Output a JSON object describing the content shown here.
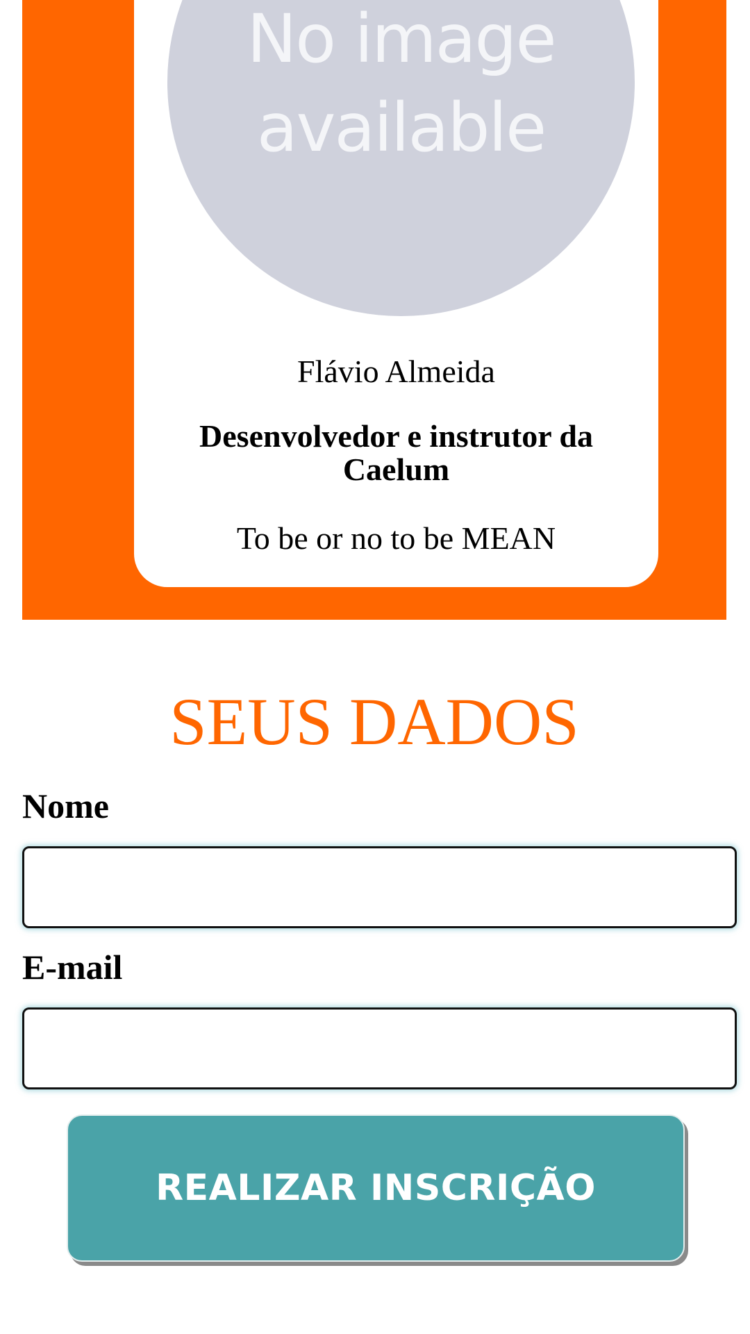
{
  "speaker": {
    "avatar_placeholder_line1": "No image",
    "avatar_placeholder_line2": "available",
    "name": "Flávio Almeida",
    "role": "Desenvolvedor e instrutor da Caelum",
    "talk": "To be or no to be MEAN"
  },
  "form": {
    "title": "SEUS DADOS",
    "name_label": "Nome",
    "name_value": "",
    "email_label": "E-mail",
    "email_value": "",
    "submit_label": "REALIZAR INSCRIÇÃO"
  },
  "colors": {
    "accent": "#ff6600",
    "button": "#4aa3a8",
    "avatar_placeholder": "#cfd1dc"
  }
}
